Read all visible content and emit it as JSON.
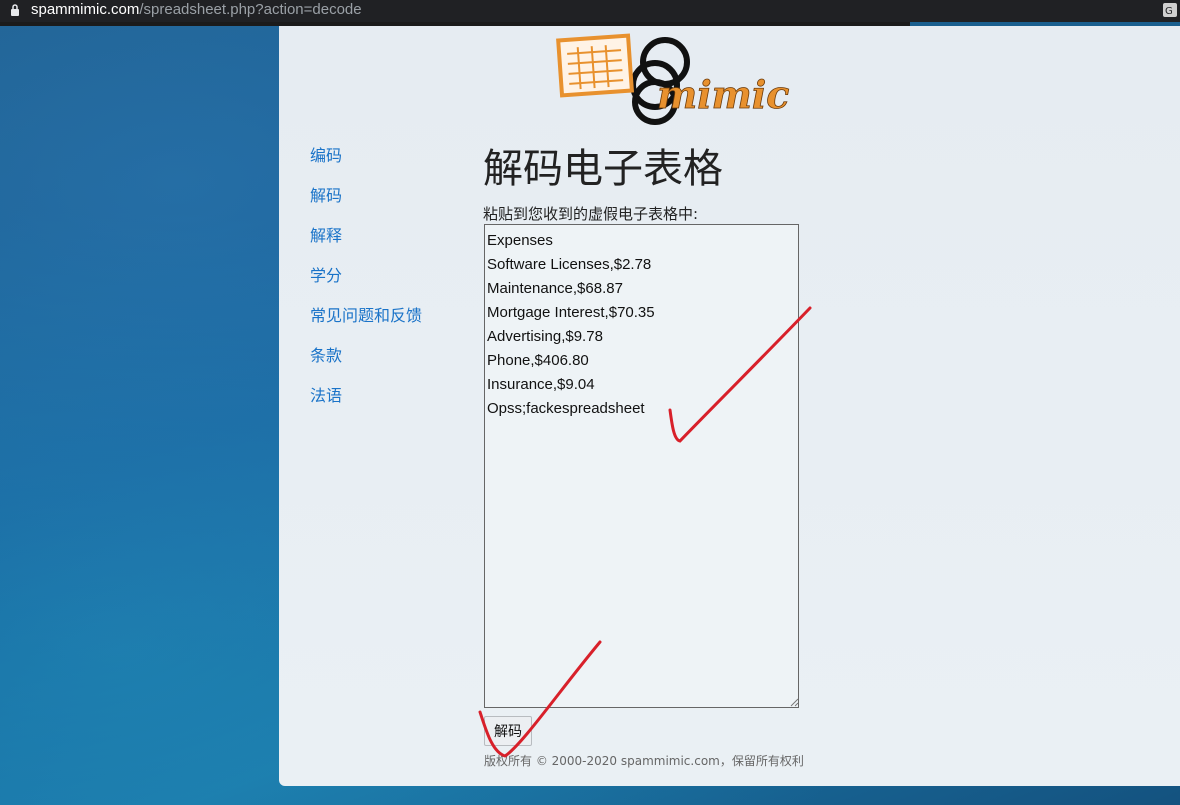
{
  "browser": {
    "url_host": "spammimic.com",
    "url_path": "/spreadsheet.php?action=decode"
  },
  "logo": {
    "text": "mimic"
  },
  "nav": {
    "items": [
      {
        "label": "编码"
      },
      {
        "label": "解码"
      },
      {
        "label": "解释"
      },
      {
        "label": "学分"
      },
      {
        "label": "常见问题和反馈"
      },
      {
        "label": "条款"
      },
      {
        "label": "法语"
      }
    ]
  },
  "main": {
    "title": "解码电子表格",
    "instruction": "粘贴到您收到的虚假电子表格中:",
    "textarea_value": "Expenses\nSoftware Licenses,$2.78\nMaintenance,$68.87\nMortgage Interest,$70.35\nAdvertising,$9.78\nPhone,$406.80\nInsurance,$9.04\nOpss;fackespreadsheet",
    "decode_button": "解码",
    "copyright": "版权所有 © 2000-2020 spammimic.com，保留所有权利"
  },
  "colors": {
    "nav_link": "#1a73c8",
    "logo_orange": "#e8912e",
    "annotation_red": "#d8202a"
  }
}
